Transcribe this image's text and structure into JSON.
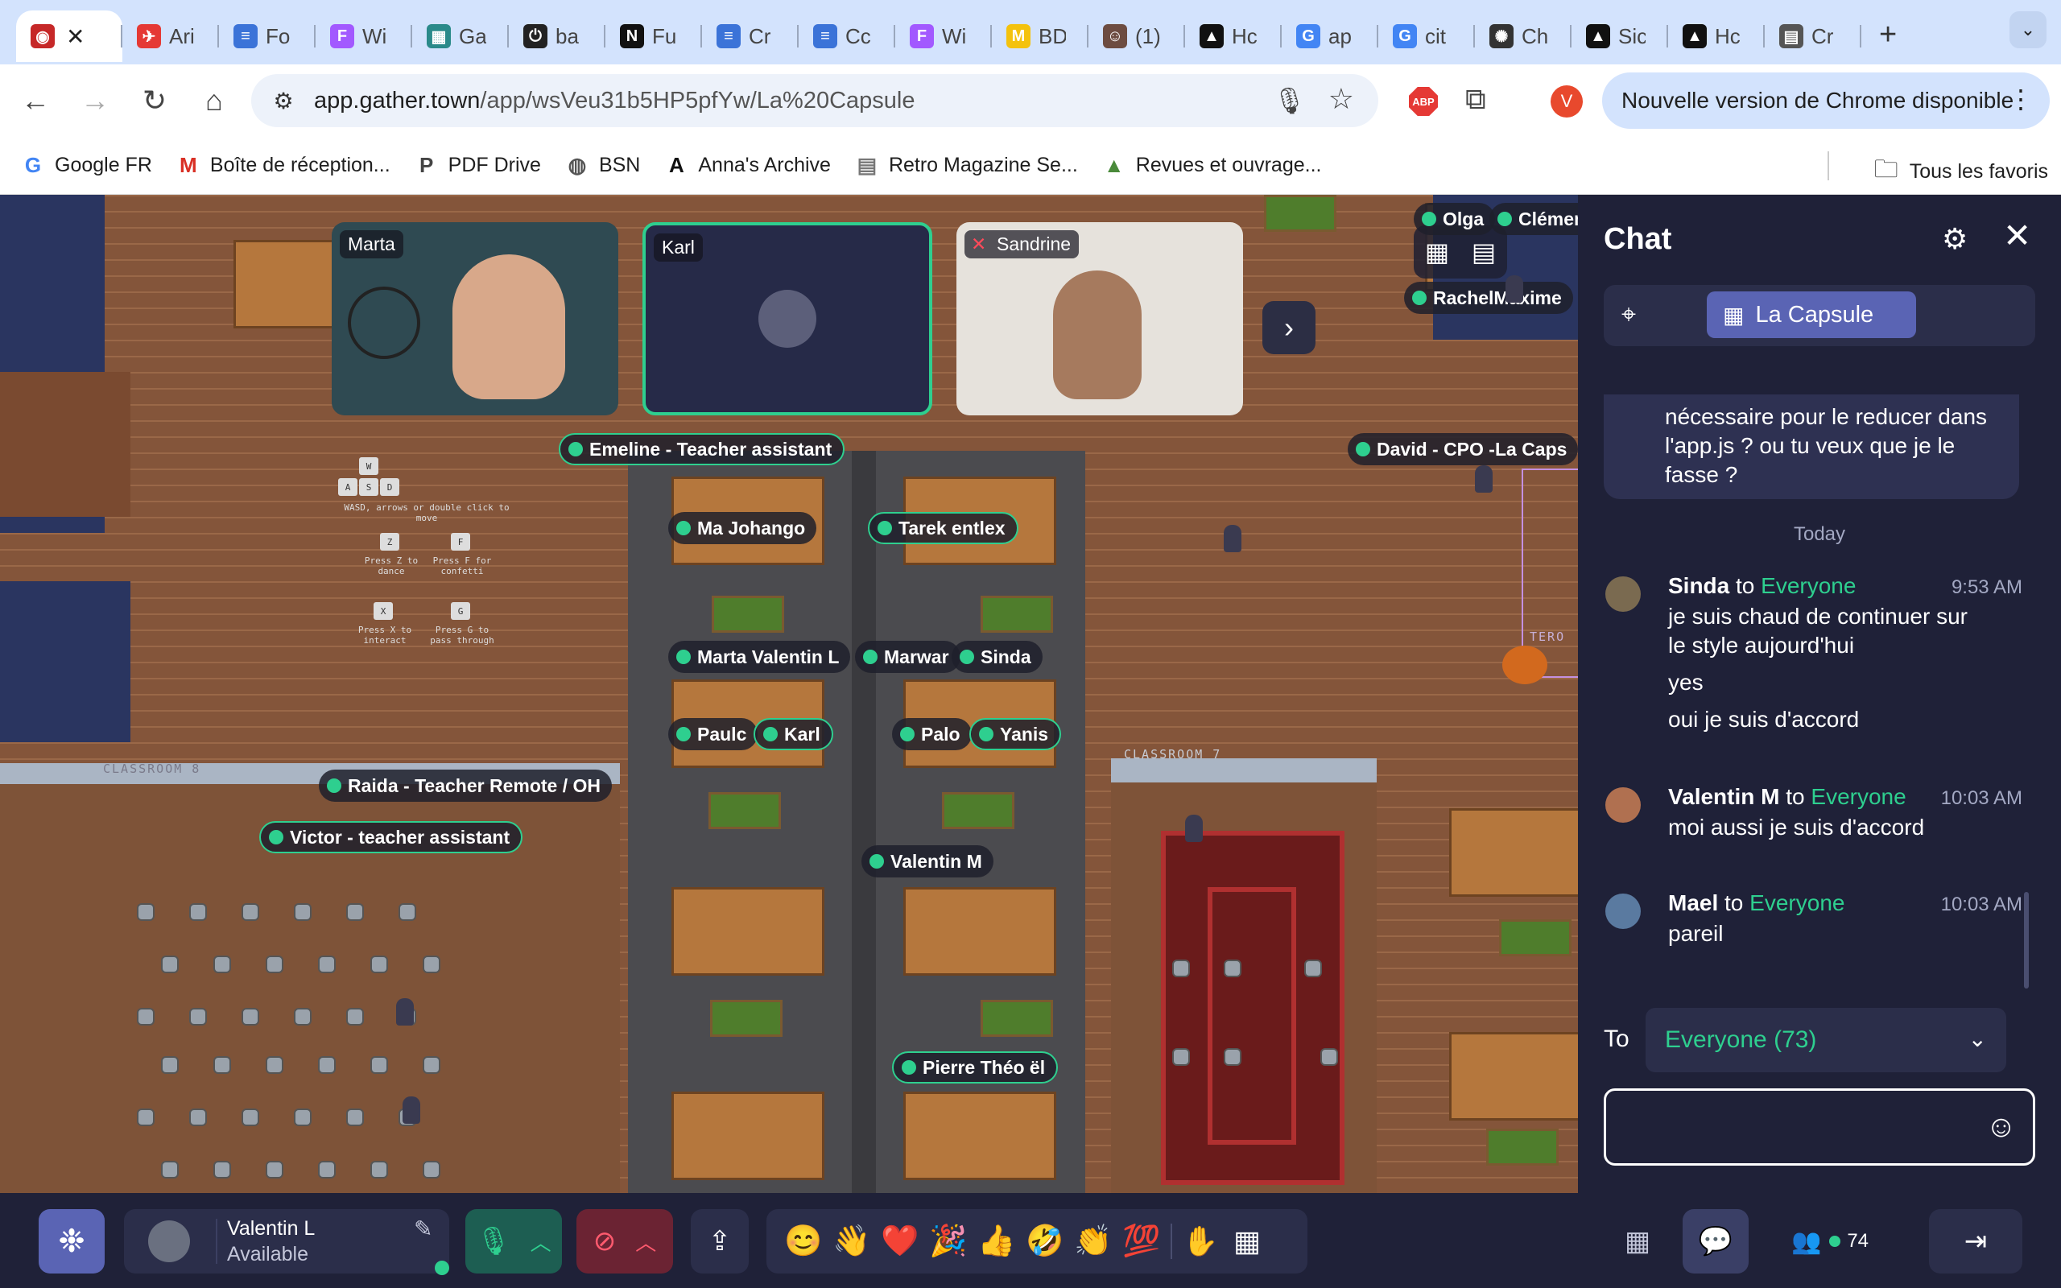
{
  "browser": {
    "tabs": [
      {
        "title": "",
        "icon": "recording-icon",
        "color": "#c62828",
        "active": true,
        "glyph": "◉"
      },
      {
        "title": "Ari",
        "icon": "paper-plane-icon",
        "color": "#e53935",
        "glyph": "✈"
      },
      {
        "title": "Fo",
        "icon": "google-docs-icon",
        "color": "#3b73d8",
        "glyph": "≡"
      },
      {
        "title": "Wi",
        "icon": "figma-icon",
        "color": "#a259ff",
        "glyph": "F"
      },
      {
        "title": "Ga",
        "icon": "gallery-icon",
        "color": "#2a8a8a",
        "glyph": "▦"
      },
      {
        "title": "ba",
        "icon": "power-icon",
        "color": "#222222",
        "glyph": "⏻"
      },
      {
        "title": "Fu",
        "icon": "notion-icon",
        "color": "#111111",
        "glyph": "N"
      },
      {
        "title": "Cr",
        "icon": "google-docs-icon",
        "color": "#3b73d8",
        "glyph": "≡"
      },
      {
        "title": "Cc",
        "icon": "google-docs-icon",
        "color": "#3b73d8",
        "glyph": "≡"
      },
      {
        "title": "Wi",
        "icon": "figma-icon",
        "color": "#a259ff",
        "glyph": "F"
      },
      {
        "title": "BD",
        "icon": "m-logo-icon",
        "color": "#f4c20d",
        "glyph": "M"
      },
      {
        "title": "(1)",
        "icon": "person-icon",
        "color": "#6d4c41",
        "glyph": "☺"
      },
      {
        "title": "Hc",
        "icon": "triangle-logo-icon",
        "color": "#111111",
        "glyph": "▲"
      },
      {
        "title": "ap",
        "icon": "google-icon",
        "color": "#4285f4",
        "glyph": "G"
      },
      {
        "title": "cit",
        "icon": "google-icon",
        "color": "#4285f4",
        "glyph": "G"
      },
      {
        "title": "Ch",
        "icon": "openai-icon",
        "color": "#333333",
        "glyph": "✺"
      },
      {
        "title": "Sic",
        "icon": "triangle-logo-icon",
        "color": "#111111",
        "glyph": "▲"
      },
      {
        "title": "Hc",
        "icon": "triangle-logo-icon",
        "color": "#111111",
        "glyph": "▲"
      },
      {
        "title": "Cr",
        "icon": "document-icon",
        "color": "#555555",
        "glyph": "▤"
      }
    ],
    "url_domain": "app.gather.town",
    "url_path": "/app/wsVeu31b5HP5pfYw/La%20Capsule",
    "profile_initial": "V",
    "abp_label": "ABP",
    "update_text": "Nouvelle version de Chrome disponible",
    "bookmarks": [
      {
        "label": "Google FR",
        "icon": "google-icon",
        "glyph": "G",
        "color": "#4285f4"
      },
      {
        "label": "Boîte de réception...",
        "icon": "gmail-icon",
        "glyph": "M",
        "color": "#d93025"
      },
      {
        "label": "PDF Drive",
        "icon": "pdf-icon",
        "glyph": "P",
        "color": "#444444"
      },
      {
        "label": "BSN",
        "icon": "globe-icon",
        "glyph": "◍",
        "color": "#555555"
      },
      {
        "label": "Anna's Archive",
        "icon": "annas-archive-icon",
        "glyph": "A",
        "color": "#111111"
      },
      {
        "label": "Retro Magazine Se...",
        "icon": "magazine-icon",
        "glyph": "▤",
        "color": "#777777"
      },
      {
        "label": "Revues et ouvrage...",
        "icon": "mountain-icon",
        "glyph": "▲",
        "color": "#4a8a3a"
      }
    ],
    "all_bookmarks": "Tous les favoris"
  },
  "map": {
    "video_tiles": [
      {
        "name": "Marta"
      },
      {
        "name": "Karl"
      },
      {
        "name": "Sandrine"
      }
    ],
    "nameplates": [
      {
        "text": "Emeline - Teacher assistant",
        "hl": true
      },
      {
        "text": "David - CPO -La Caps",
        "hl": false
      },
      {
        "text": "Olga",
        "hl": false
      },
      {
        "text": "Clémen",
        "hl": false
      },
      {
        "text": "RachelMaxime",
        "hl": false
      },
      {
        "text": "Ma Johango",
        "hl": false
      },
      {
        "text": "Tarek entlex",
        "hl": true
      },
      {
        "text": "Marta Valentin L",
        "hl": false
      },
      {
        "text": "Marwar",
        "hl": false
      },
      {
        "text": "Sinda",
        "hl": false
      },
      {
        "text": "Paulc",
        "hl": false
      },
      {
        "text": "Karl",
        "hl": true
      },
      {
        "text": "Palo",
        "hl": false
      },
      {
        "text": "Yanis",
        "hl": true
      },
      {
        "text": "Raida - Teacher Remote / OH",
        "hl": false
      },
      {
        "text": "Victor - teacher assistant",
        "hl": true
      },
      {
        "text": "Valentin M",
        "hl": false
      },
      {
        "text": "Pierre Théo ël",
        "hl": true
      }
    ],
    "help": {
      "move": "WASD, arrows or double click to move",
      "dance": "Press Z to dance",
      "confetti": "Press F for confetti",
      "interact": "Press X to interact",
      "ghost": "Press G to pass through",
      "keys_w": "W",
      "keys_a": "A",
      "keys_s": "S",
      "keys_d": "D",
      "keys_z": "Z",
      "keys_f": "F",
      "keys_x": "X",
      "keys_g": "G"
    },
    "room_labels": [
      "CLASSROOM 7",
      "CLASSROOM 8",
      "TERO"
    ]
  },
  "chat": {
    "title": "Chat",
    "room_chip": "La Capsule",
    "previous_message": [
      "nécessaire pour le reducer dans",
      "l'app.js ? ou tu veux que je le",
      "fasse ?"
    ],
    "day_separator": "Today",
    "messages": [
      {
        "sender": "Sinda",
        "to": "to",
        "recipient": "Everyone",
        "time": "9:53 AM",
        "lines": [
          "je suis chaud de continuer sur",
          "le style aujourd'hui"
        ],
        "extra": [
          "yes",
          "oui je suis d'accord"
        ]
      },
      {
        "sender": "Valentin M",
        "to": "to",
        "recipient": "Everyone",
        "time": "10:03 AM",
        "lines": [
          "moi aussi je suis d'accord"
        ],
        "extra": []
      },
      {
        "sender": "Mael",
        "to": "to",
        "recipient": "Everyone",
        "time": "10:03 AM",
        "lines": [
          "pareil"
        ],
        "extra": []
      }
    ],
    "to_label": "To",
    "to_value": "Everyone (73)",
    "input_value": ""
  },
  "bottom_bar": {
    "user_name": "Valentin L",
    "user_status": "Available",
    "reactions": [
      "😊",
      "👋",
      "❤️",
      "🎉",
      "👍",
      "🤣",
      "👏",
      "💯"
    ],
    "participants_count": "74"
  },
  "colors": {
    "accent_green": "#2ecf8f",
    "panel_bg": "#1f2138",
    "chip_blue": "#5a64b4"
  }
}
